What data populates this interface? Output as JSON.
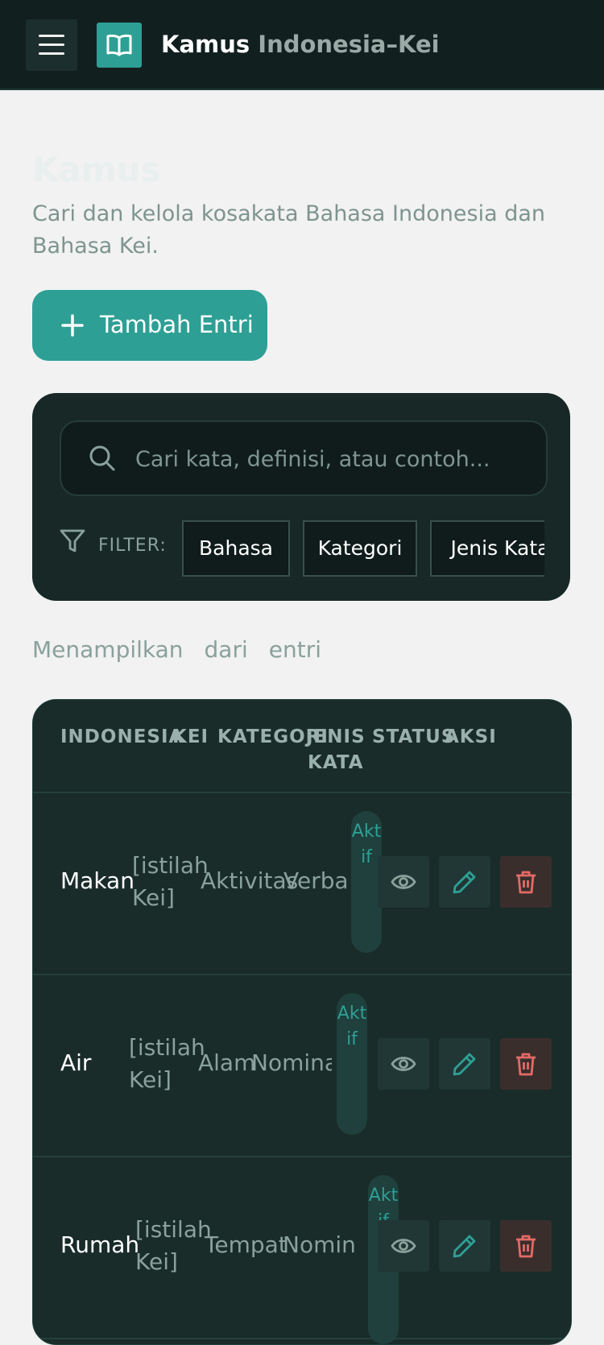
{
  "header": {
    "brand_main": "Kamus",
    "brand_sub": "Indonesia–Kei",
    "menu_icon": "hamburger-menu-icon",
    "logo_icon": "open-book-icon"
  },
  "page": {
    "title": "Kamus",
    "description": "Cari dan kelola kosakata Bahasa Indonesia dan Bahasa Kei."
  },
  "add_button": {
    "label": "Tambah Entri",
    "icon": "plus-icon"
  },
  "search": {
    "placeholder": "Cari kata, definisi, atau contoh...",
    "value": "",
    "icon": "search-icon"
  },
  "filter": {
    "label": "FILTER:",
    "icon": "funnel-icon",
    "chips": [
      "Bahasa",
      "Kategori",
      "Jenis Kata"
    ]
  },
  "results": {
    "prefix": "Menampilkan",
    "middle": "dari",
    "suffix": "entri"
  },
  "table": {
    "headers": {
      "indonesia": "INDONESIA",
      "kei": "KEI",
      "kategori": "KATEGORI",
      "jenis": "JENIS",
      "jenis_2": "KATA",
      "status": "STATUS",
      "aksi": "AKSI"
    },
    "rows": [
      {
        "indonesia": "Makan",
        "kei": "[istilah Kei]",
        "kategori": "Aktivitas",
        "jenis": "Verba",
        "status": "Aktif"
      },
      {
        "indonesia": "Air",
        "kei": "[istilah Kei]",
        "kategori": "Alam",
        "jenis": "Nomina",
        "status": "Aktif"
      },
      {
        "indonesia": "Rumah",
        "kei": "[istilah Kei]",
        "kategori": "Tempat",
        "jenis": "Nomina",
        "status": "Aktif"
      }
    ],
    "action_icons": [
      "eye-icon",
      "pencil-icon",
      "trash-icon"
    ]
  },
  "colors": {
    "accent": "#2e9f95",
    "header_bg": "#121f1f",
    "card_bg": "#172826",
    "danger": "#e46a66"
  }
}
